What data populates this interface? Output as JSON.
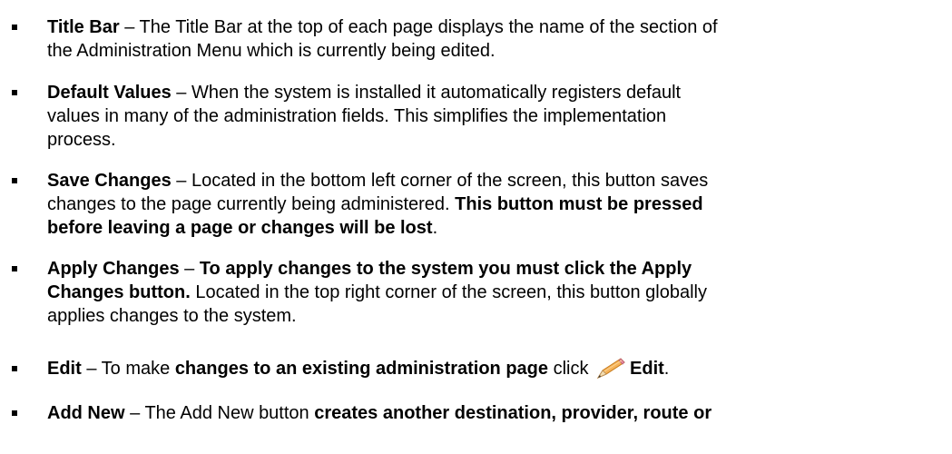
{
  "items": [
    {
      "term": "Title Bar",
      "l1": " – The Title Bar at the top of each page displays the name of the section of",
      "l2": "the Administration Menu which is currently being edited."
    },
    {
      "term": "Default Values",
      "l1": " – When the system is installed it automatically registers default",
      "l2": "values in many of the administration fields. This simplifies the implementation",
      "l3": "process."
    },
    {
      "term": "Save Changes",
      "l1": " – Located in the bottom left corner of the screen, this button saves",
      "l2": "changes to the page currently being administered. ",
      "l2_bold": "This button must be pressed",
      "l3_bold": "before leaving a page or changes will be lost",
      "l3_end": "."
    },
    {
      "term": "Apply Changes",
      "l1_sep": " – ",
      "l1_bold": "To apply changes to the system you must click the Apply",
      "l2_bold": "Changes button.",
      "l2": " Located in the top right corner of the screen, this button globally",
      "l3": "applies changes to the system."
    },
    {
      "term": "Edit",
      "l1_pre": " – To make ",
      "l1_bold": "changes to an existing administration page",
      "l1_mid": " click ",
      "icon": "pencil-icon",
      "l1_bold2": "Edit",
      "l1_end": "."
    },
    {
      "term": "Add New",
      "l1_pre": " – The Add New button ",
      "l1_bold": "creates another destination, provider, route or"
    }
  ]
}
